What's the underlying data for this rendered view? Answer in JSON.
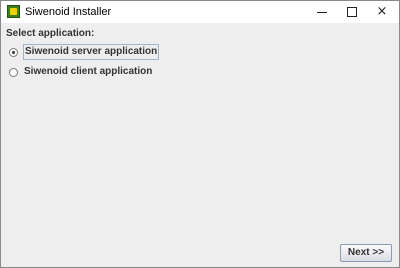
{
  "window": {
    "title": "Siwenoid Installer",
    "icon": "siwenoid-app-icon",
    "controls": {
      "minimize": "minimize-icon",
      "maximize": "maximize-icon",
      "close": "×"
    }
  },
  "main": {
    "heading": "Select application:",
    "options": [
      {
        "label": "Siwenoid server application",
        "selected": true
      },
      {
        "label": "Siwenoid client application",
        "selected": false
      }
    ]
  },
  "footer": {
    "next_label": "Next >>"
  }
}
